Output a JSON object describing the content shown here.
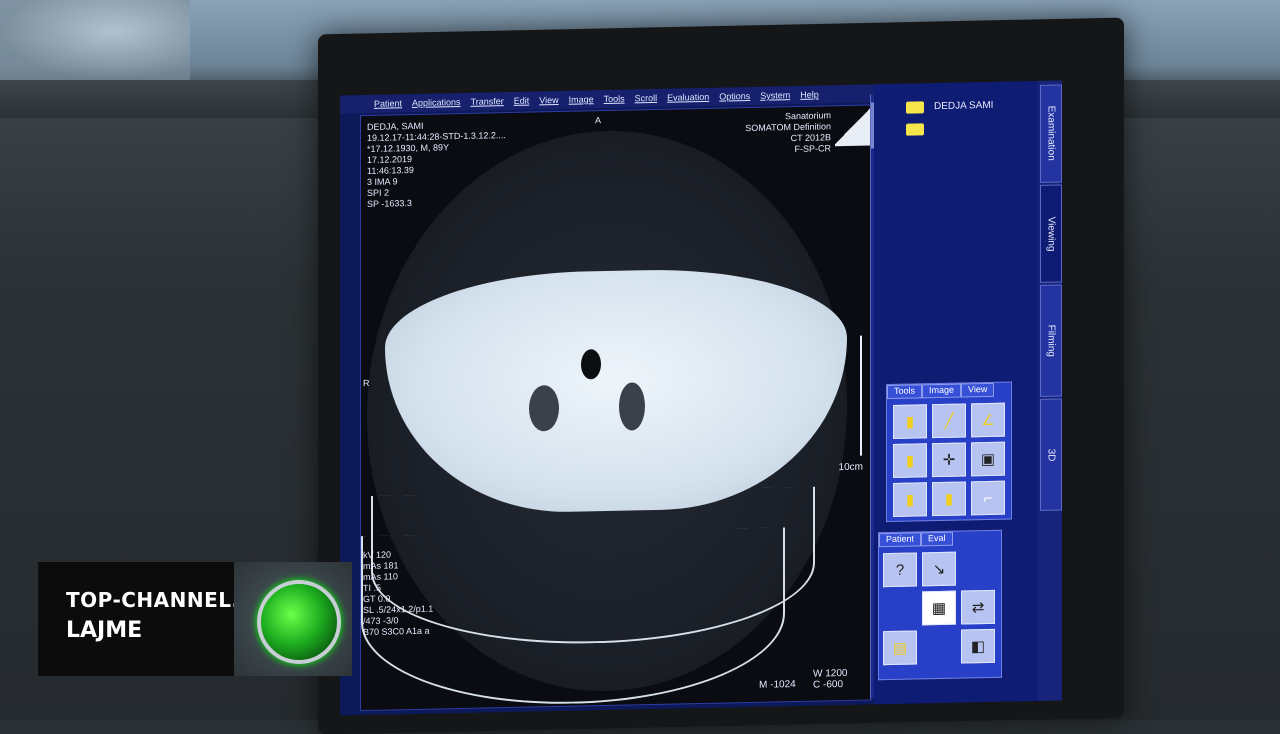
{
  "menu": [
    "Patient",
    "Applications",
    "Transfer",
    "Edit",
    "View",
    "Image",
    "Tools",
    "Scroll",
    "Evaluation",
    "Options",
    "System",
    "Help"
  ],
  "overlay_top_left": [
    "DEDJA, SAMI",
    "19.12.17-11:44:28-STD-1.3.12.2....",
    "*17.12.1930, M, 89Y",
    "17.12.2019",
    "11:46:13.39",
    "3 IMA 9",
    "SPI 2",
    "SP -1633.3"
  ],
  "overlay_top_right": [
    "Sanatorium",
    "SOMATOM Definition",
    "CT 2012B",
    "F-SP-CR"
  ],
  "orientation_top": "A",
  "orientation_left": "R",
  "scale_label": "10cm",
  "overlay_bottom_left": [
    "kV 120",
    "mAs 181",
    "mAs 110",
    "TI .5",
    "GT 0.0",
    "SL .5/24x1.2/p1.1",
    "/473 -3/0",
    "B70 S3C0 A1a a"
  ],
  "window_w_label": "W",
  "window_w_value": "1200",
  "window_c_label": "C",
  "window_c_value": "-600",
  "pixel_value": "-1024",
  "pixel_marker": "M",
  "patient_folder": "DEDJA SAMI",
  "side_tabs": [
    "Examination",
    "Viewing",
    "Filming",
    "3D"
  ],
  "tool_panel_tabs": [
    "Tools",
    "Image",
    "View"
  ],
  "patient_panel_tabs": [
    "Patient",
    "Eval"
  ],
  "logo": {
    "site": "TOP-CHANNEL.TV",
    "program": "LAJME"
  }
}
